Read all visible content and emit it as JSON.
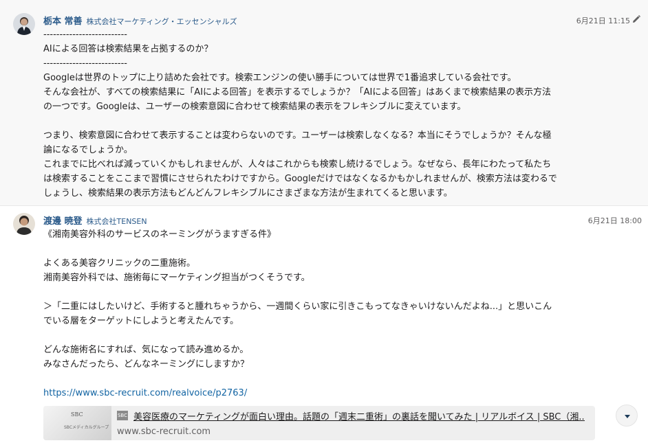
{
  "messages": [
    {
      "sender": "栃本 常善",
      "company": "株式会社マーケティング・エッセンシャルズ",
      "timestamp": "6月21日 11:15",
      "lines": [
        "--------------------------",
        "AIによる回答は検索結果を占拠するのか？",
        "--------------------------",
        "Googleは世界のトップに上り詰めた会社です。検索エンジンの使い勝手については世界で1番追求している会社です。",
        "そんな会社が、すべての検索結果に「AIによる回答」を表示するでしょうか？「AIによる回答」はあくまで検索結果の表示方法",
        "の一つです。Googleは、ユーザーの検索意図に合わせて検索結果の表示をフレキシブルに変えています。",
        "",
        "つまり、検索意図に合わせて表示することは変わらないのです。ユーザーは検索しなくなる？本当にそうでしょうか？そんな極",
        "論になるでしょうか。",
        "これまでに比べれば減っていくかもしれませんが、人々はこれからも検索し続けるでしょう。なぜなら、長年にわたって私たち",
        "は検索することをここまで習慣にさせられたわけですから。Googleだけではなくなるかもかしれませんが、検索方法は変わるで",
        "しょうし、検索結果の表示方法もどんどんフレキシブルにさまざまな方法が生まれてくると思います。"
      ]
    },
    {
      "sender": "渡邊 暁登",
      "company": "株式会社TENSEN",
      "timestamp": "6月21日 18:00",
      "lines": [
        "《湘南美容外科のサービスのネーミングがうますぎる件》",
        "",
        "よくある美容クリニックの二重施術。",
        "湘南美容外科では、施術毎にマーケティング担当がつくそうです。",
        "",
        "＞「二重にはしたいけど、手術すると腫れちゃうから、一週間くらい家に引きこもってなきゃいけないんだよね...」と思いこん",
        "でいる層をターゲットにしようと考えたんです。",
        "",
        "どんな施術名にすれば、気になって読み進めるか。",
        "みなさんだったら、どんなネーミングにしますか？",
        ""
      ],
      "link": "https://www.sbc-recruit.com/realvoice/p2763/",
      "unfurl": {
        "thumb_title": "SBC",
        "thumb_sub": "SBCメディカルグループ",
        "favicon": "SBC",
        "title": "美容医療のマーケティングが面白い理由。話題の「週末二重術」の裏話を聞いてみた | リアルボイス | SBC（湘...",
        "domain": "www.sbc-recruit.com"
      }
    }
  ],
  "colors": {
    "sender": "#2a5a8a",
    "link": "#1264a3",
    "highlight_bg": "#f8f8f8"
  },
  "icons": {
    "edit": "pencil-icon",
    "scroll": "chevron-down-icon"
  }
}
